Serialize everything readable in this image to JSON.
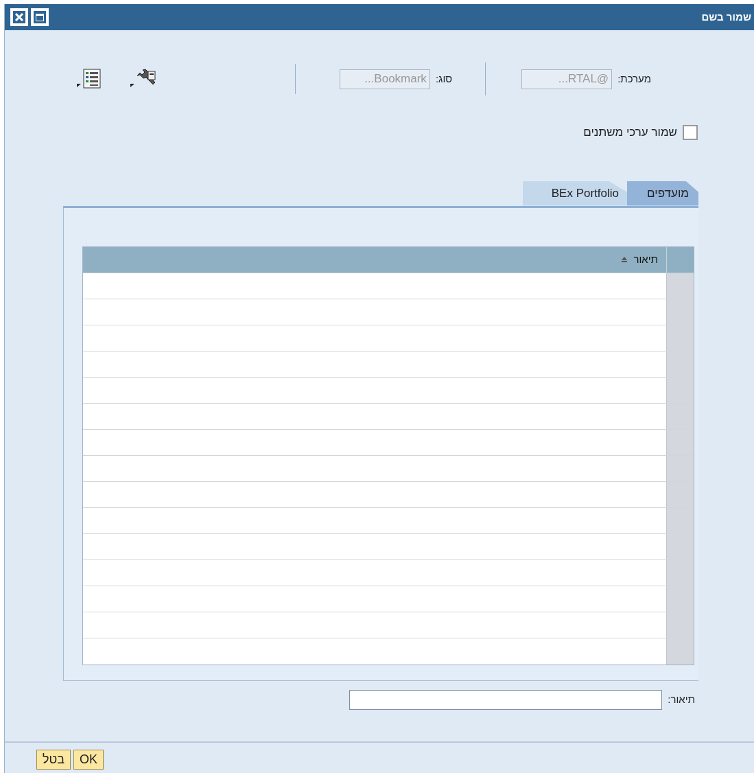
{
  "window": {
    "title": "שמור בשם"
  },
  "fields": [
    {
      "label": "מערכת:",
      "value": "...RTAL@",
      "disabled": true
    },
    {
      "label": "סוג:",
      "value": "...Bookmark",
      "disabled": true
    }
  ],
  "save_variables": {
    "label": "שמור ערכי משתנים",
    "checked": false
  },
  "tabs": [
    {
      "label": "מועדפים",
      "selected": true
    },
    {
      "label": "BEx Portfolio",
      "selected": false
    }
  ],
  "table": {
    "columns": [
      {
        "label": "תיאור",
        "sorted": true
      }
    ]
  },
  "description": {
    "label": "תיאור:"
  },
  "buttons": [
    "OK",
    "בטל"
  ]
}
